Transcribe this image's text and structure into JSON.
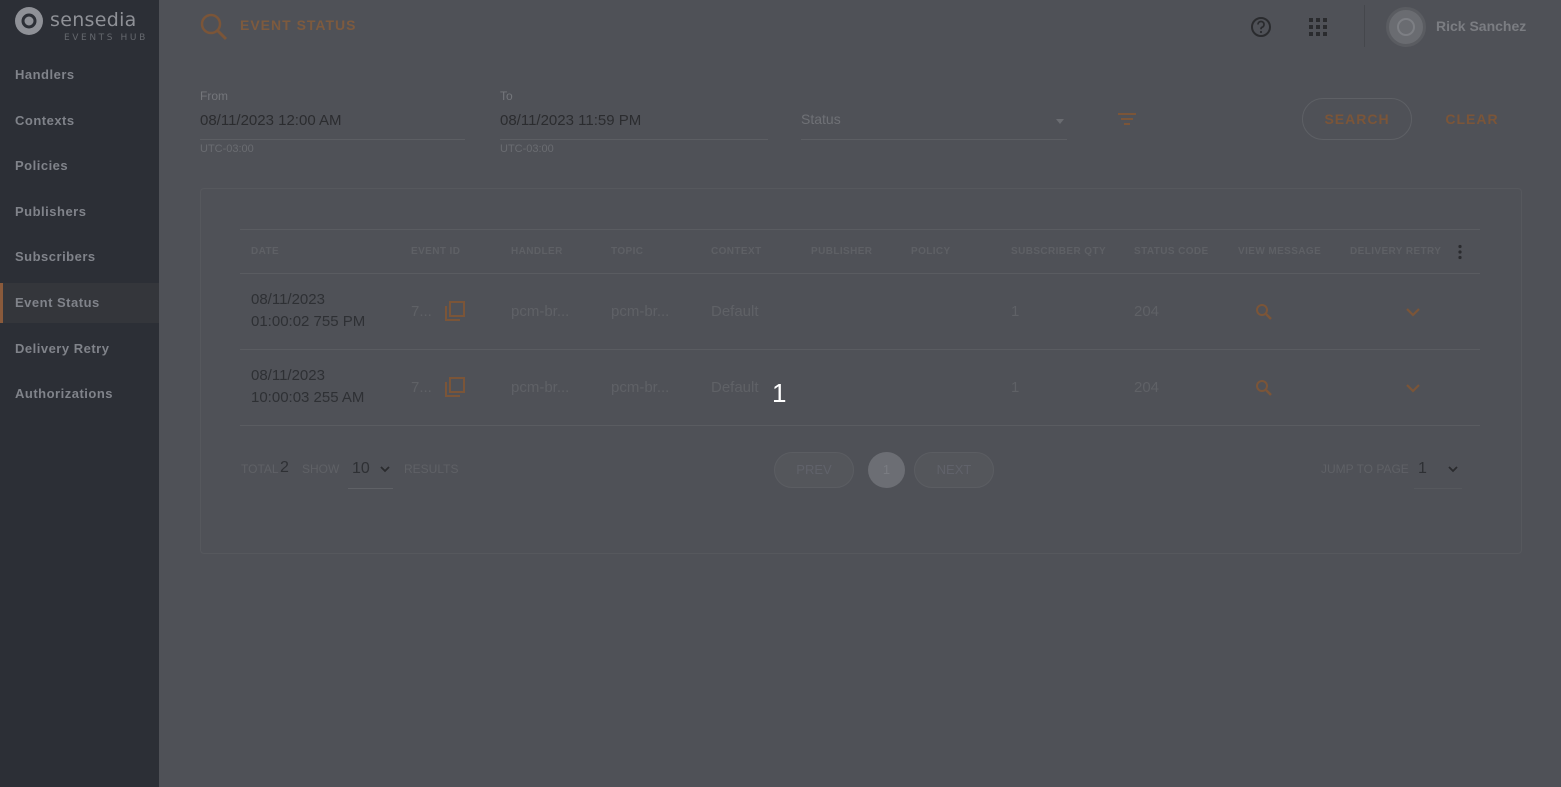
{
  "sidebar": {
    "logo_text": "sensedia",
    "logo_sub": "EVENTS HUB",
    "items": [
      {
        "label": "Handlers"
      },
      {
        "label": "Contexts"
      },
      {
        "label": "Policies"
      },
      {
        "label": "Publishers"
      },
      {
        "label": "Subscribers"
      },
      {
        "label": "Event Status"
      },
      {
        "label": "Delivery Retry"
      },
      {
        "label": "Authorizations"
      }
    ]
  },
  "header": {
    "title": "EVENT STATUS",
    "user_name": "Rick Sanchez"
  },
  "filters": {
    "from_label": "From",
    "from_value": "08/11/2023 12:00 AM",
    "from_hint": "UTC-03:00",
    "to_label": "To",
    "to_value": "08/11/2023 11:59 PM",
    "to_hint": "UTC-03:00",
    "status_placeholder": "Status",
    "search_label": "SEARCH",
    "clear_label": "CLEAR"
  },
  "table": {
    "columns": [
      "DATE",
      "EVENT ID",
      "HANDLER",
      "TOPIC",
      "CONTEXT",
      "PUBLISHER",
      "POLICY",
      "SUBSCRIBER QTY",
      "STATUS CODE",
      "VIEW MESSAGE",
      "DELIVERY RETRY"
    ],
    "rows": [
      {
        "date_line1": "08/11/2023",
        "date_line2": "01:00:02 755 PM",
        "event_id": "7...",
        "handler": "pcm-br...",
        "topic": "pcm-br...",
        "context": "Default",
        "publisher": "",
        "policy": "",
        "subscriber_qty": "1",
        "status_code": "204"
      },
      {
        "date_line1": "08/11/2023",
        "date_line2": "10:00:03 255 AM",
        "event_id": "7...",
        "handler": "pcm-br...",
        "topic": "pcm-br...",
        "context": "Default",
        "publisher": "",
        "policy": "",
        "subscriber_qty": "1",
        "status_code": "204"
      }
    ]
  },
  "pagination": {
    "total_label": "TOTAL",
    "total_value": "2",
    "show_label": "SHOW",
    "show_value": "10",
    "results_label": "RESULTS",
    "prev_label": "PREV",
    "current_page": "1",
    "next_label": "NEXT",
    "jump_label": "JUMP TO PAGE",
    "jump_value": "1"
  },
  "overlay": {
    "number": "1"
  },
  "colors": {
    "accent": "#7b5538",
    "sidebar_bg": "#2c2f36",
    "main_bg": "#4f5157"
  }
}
